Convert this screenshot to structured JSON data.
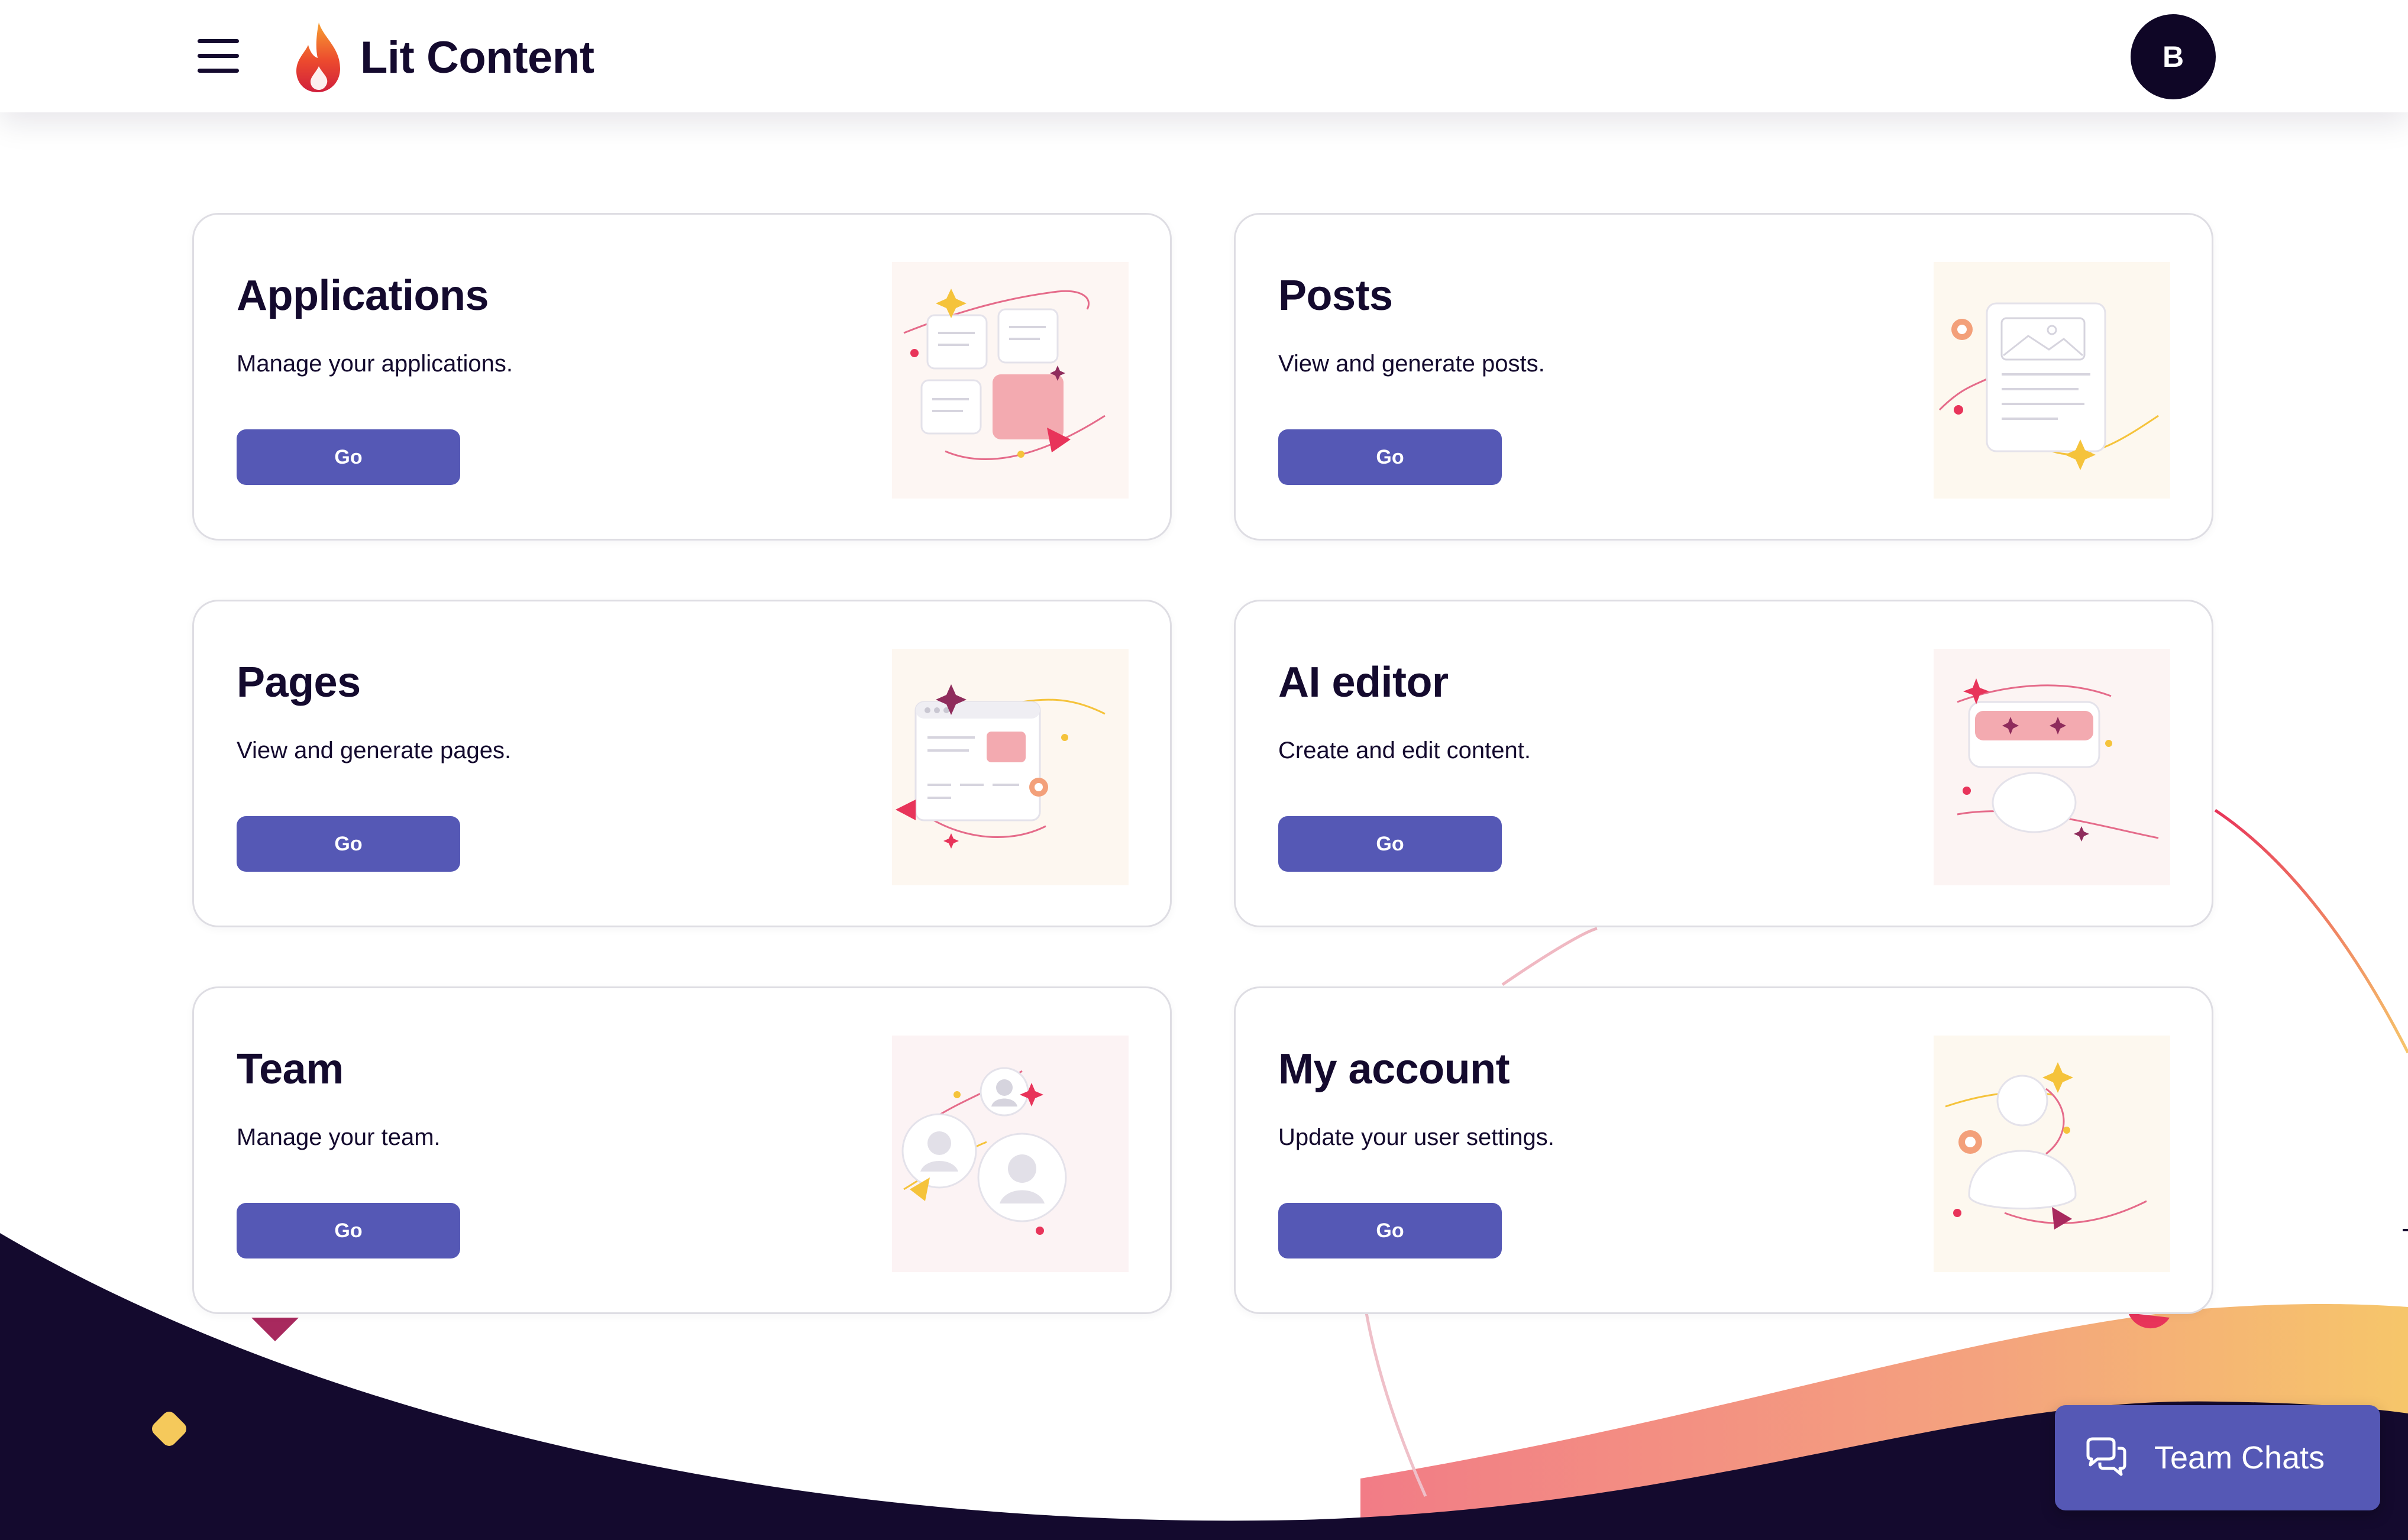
{
  "app": {
    "title": "Lit Content",
    "user_initial": "B"
  },
  "header": {
    "menu_icon": "hamburger-menu-icon",
    "logo_icon": "flame-logo-icon"
  },
  "cards": [
    {
      "title": "Applications",
      "description": "Manage your applications.",
      "button": "Go",
      "illustration": "applications-illustration"
    },
    {
      "title": "Posts",
      "description": "View and generate posts.",
      "button": "Go",
      "illustration": "posts-illustration"
    },
    {
      "title": "Pages",
      "description": "View and generate pages.",
      "button": "Go",
      "illustration": "pages-illustration"
    },
    {
      "title": "AI editor",
      "description": "Create and edit content.",
      "button": "Go",
      "illustration": "ai-editor-illustration"
    },
    {
      "title": "Team",
      "description": "Manage your team.",
      "button": "Go",
      "illustration": "team-illustration"
    },
    {
      "title": "My account",
      "description": "Update your user settings.",
      "button": "Go",
      "illustration": "my-account-illustration"
    }
  ],
  "team_chats": {
    "label": "Team Chats",
    "icon": "chat-bubbles-icon"
  },
  "colors": {
    "primary": "#5558b5",
    "dark": "#140a2e",
    "accent_pink": "#e8345a",
    "accent_yellow": "#f5c33b",
    "accent_orange": "#f3a07a"
  }
}
